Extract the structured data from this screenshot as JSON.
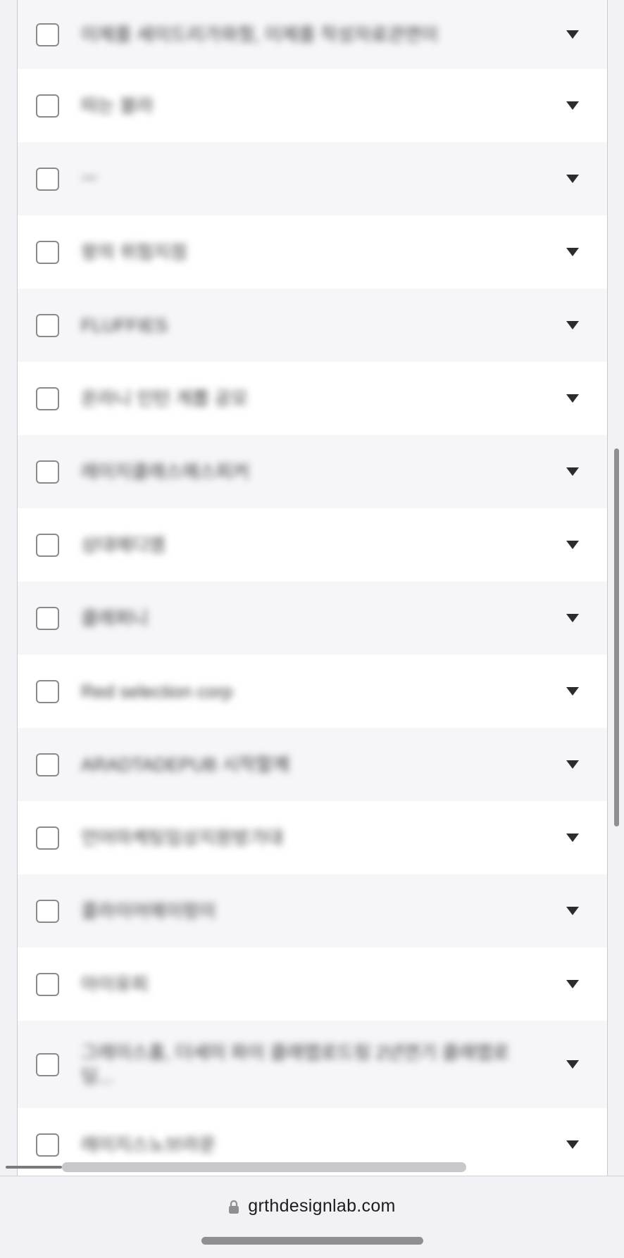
{
  "list": {
    "items": [
      {
        "label": "이제를 세이드리가와줬, 이제를 작성자료관면이"
      },
      {
        "label": "따는 블라"
      },
      {
        "label": "ㅡ"
      },
      {
        "label": "왕의 위험지점"
      },
      {
        "label": "FLUFFIES"
      },
      {
        "label": "온라니 인턴 게뽑 공모"
      },
      {
        "label": "레이지클래스에스피커"
      },
      {
        "label": "상대에디엠"
      },
      {
        "label": "클래퍼니"
      },
      {
        "label": "Red selection corp"
      },
      {
        "label": "ARADTADEPUB 시작할께"
      },
      {
        "label": "언어마케팅임상지원방가대"
      },
      {
        "label": "콜라이어에이렁이"
      },
      {
        "label": "아이유피"
      },
      {
        "label": "그레이스홈, 더세미 파이 클래맵로드링 2년연기 클래맵로딩..."
      },
      {
        "label": "레이지스노브라운"
      }
    ]
  },
  "browser": {
    "url": "grthdesignlab.com",
    "lock_icon": "lock-icon"
  }
}
